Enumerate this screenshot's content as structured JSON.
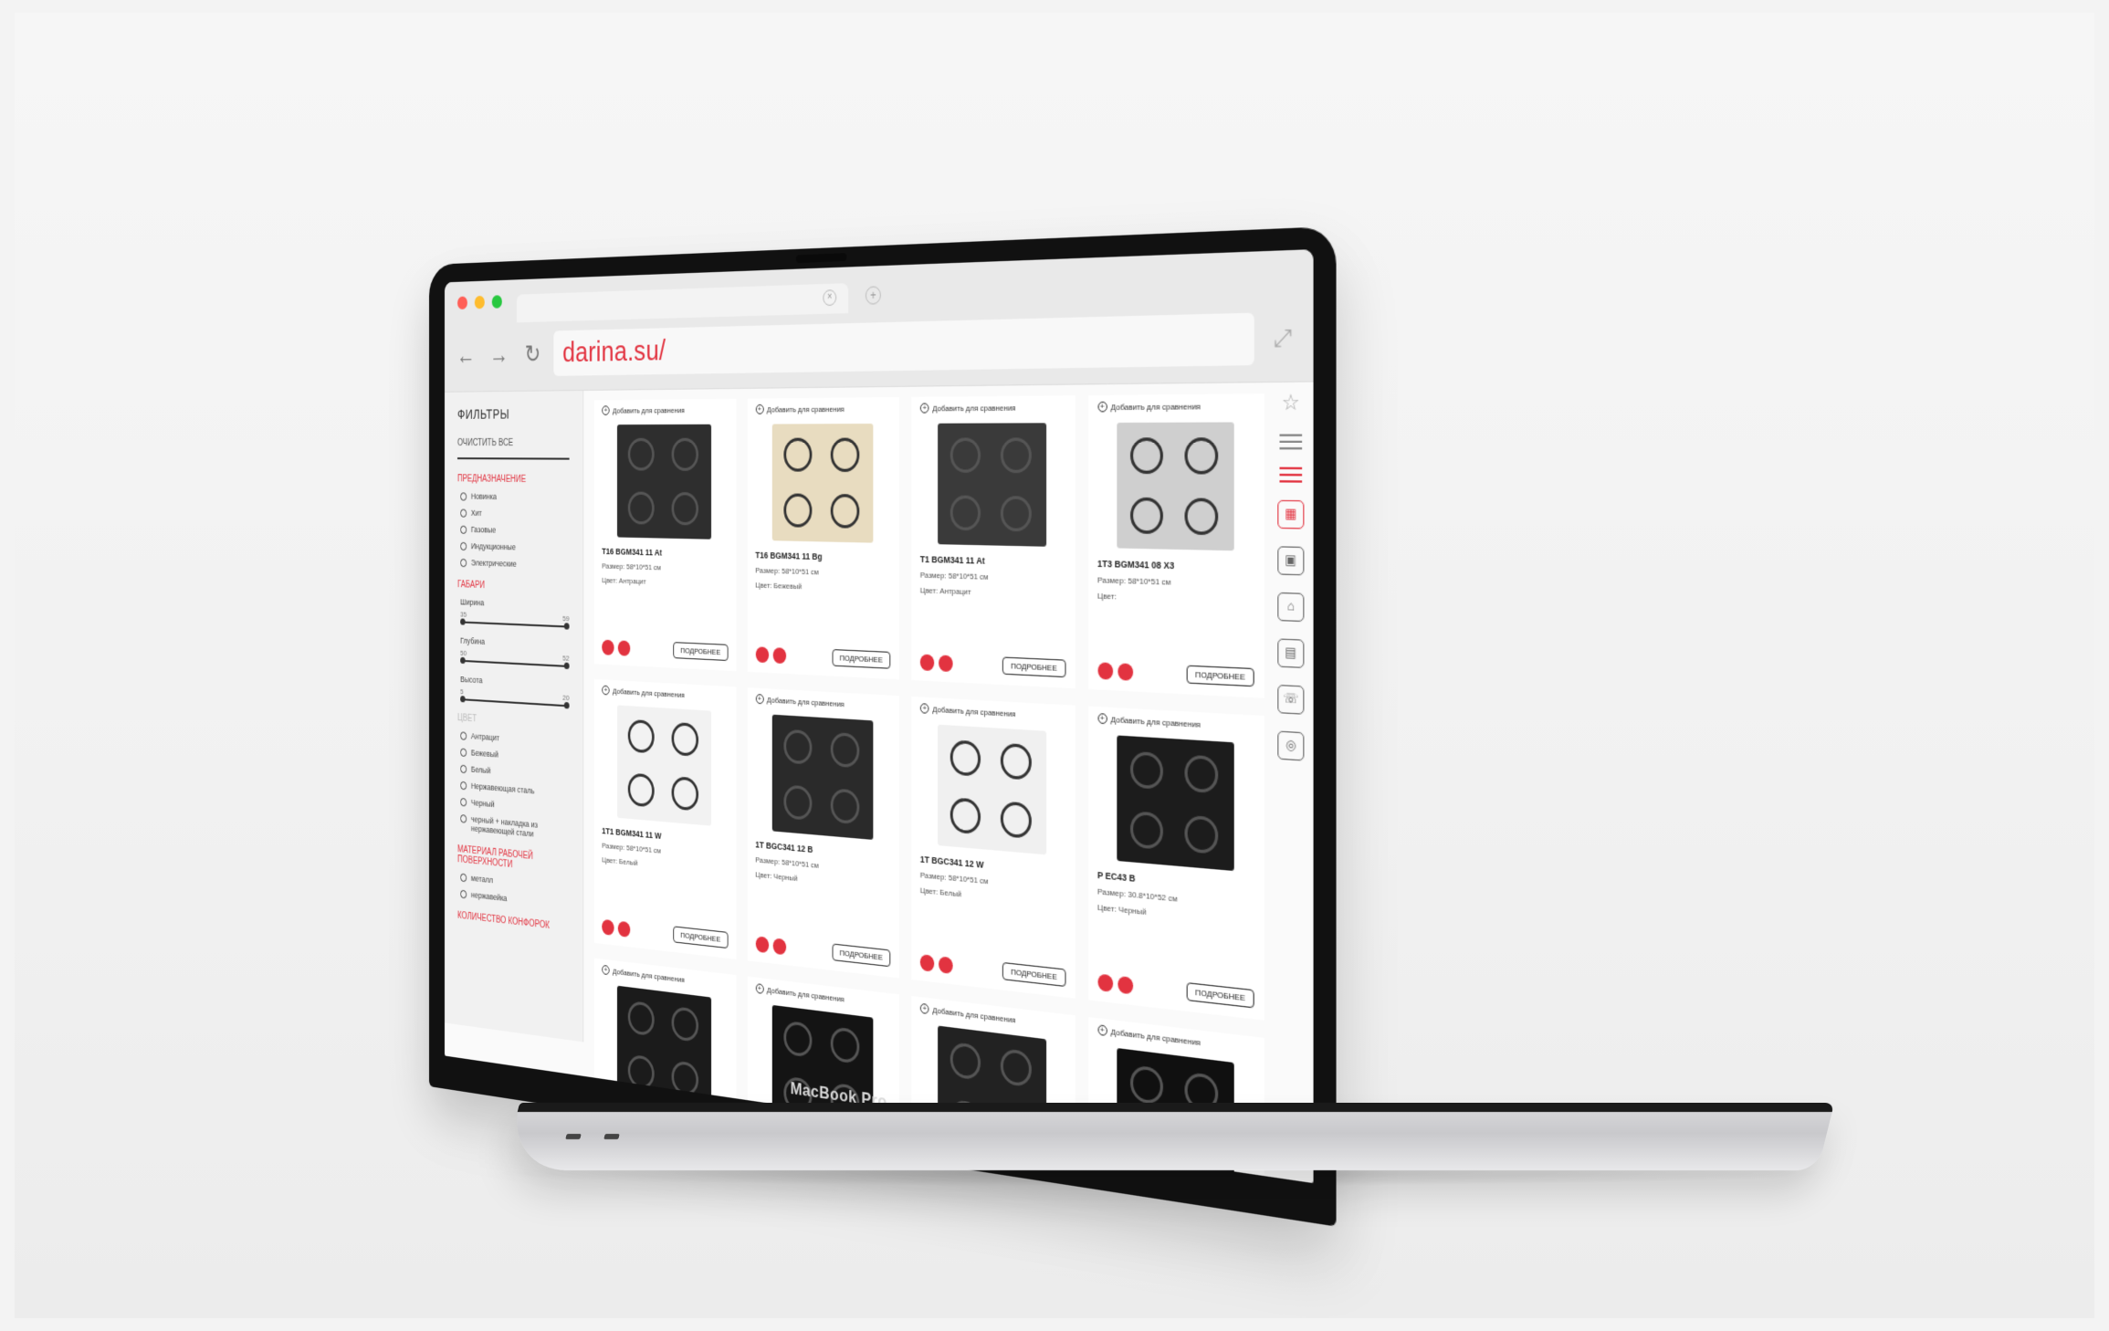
{
  "browser": {
    "url": "darina.su/"
  },
  "device": {
    "brand_label": "MacBook Pro"
  },
  "sidebar": {
    "title": "ФИЛЬТРЫ",
    "clear_all": "ОЧИСТИТЬ ВСЕ",
    "group_purpose": {
      "title": "ПРЕДНАЗНАЧЕНИЕ",
      "options": [
        "Новинка",
        "Хит",
        "Газовые",
        "Индукционные",
        "Электрические"
      ]
    },
    "group_sizes": {
      "title": "ГАБАРИ",
      "ranges": [
        {
          "label": "Ширина",
          "min": "35",
          "max": "59"
        },
        {
          "label": "Глубина",
          "min": "50",
          "max": "52"
        },
        {
          "label": "Высота",
          "min": "5",
          "max": "20"
        }
      ]
    },
    "group_color": {
      "title": "ЦВЕТ",
      "options": [
        "Антрацит",
        "Бежевый",
        "Белый",
        "Нержавеющая сталь",
        "Черный",
        "черный + накладка из нержавеющей стали"
      ]
    },
    "group_material": {
      "title": "МАТЕРИАЛ РАБОЧЕЙ ПОВЕРХНОСТИ",
      "options": [
        "металл",
        "нержавейка"
      ]
    },
    "group_burners": {
      "title": "КОЛИЧЕСТВО КОНФОРОК"
    }
  },
  "products": {
    "compare_label": "Добавить для сравнения",
    "more_label": "ПОДРОБНЕЕ",
    "row1": [
      {
        "name": "T16 BGM341 11 At",
        "size": "Размер: 58*10*51 см",
        "color": "Цвет: Антрацит",
        "swatch": "#2e2e2e"
      },
      {
        "name": "T16 BGM341 11 Bg",
        "size": "Размер: 58*10*51 см",
        "color": "Цвет: Бежевый",
        "swatch": "#e8dcc0"
      },
      {
        "name": "T1 BGM341 11 At",
        "size": "Размер: 58*10*51 см",
        "color": "Цвет: Антрацит",
        "swatch": "#3a3a3a"
      },
      {
        "name": "1T3 BGM341 08 X3",
        "size": "Размер: 58*10*51 см",
        "color": "Цвет:",
        "swatch": "#cfcfcf"
      }
    ],
    "row2": [
      {
        "name": "1T1 BGM341 11 W",
        "size": "Размер: 58*10*51 см",
        "color": "Цвет: Белый",
        "swatch": "#f2f2f2"
      },
      {
        "name": "1T BGC341 12 B",
        "size": "Размер: 58*10*51 см",
        "color": "Цвет: Черный",
        "swatch": "#2a2a2a"
      },
      {
        "name": "1T BGC341 12 W",
        "size": "Размер: 58*10*51 см",
        "color": "Цвет: Белый",
        "swatch": "#f0f0f0"
      },
      {
        "name": "P EC43 B",
        "size": "Размер: 30.8*10*52 см",
        "color": "Цвет: Черный",
        "swatch": "#1c1c1c"
      }
    ],
    "row3_swatches": [
      "#1b1b1b",
      "#141414",
      "#222222",
      "#101010"
    ]
  },
  "colors": {
    "accent": "#e23340",
    "traffic_red": "#ff5f57",
    "traffic_yellow": "#febc2e",
    "traffic_green": "#28c840"
  }
}
